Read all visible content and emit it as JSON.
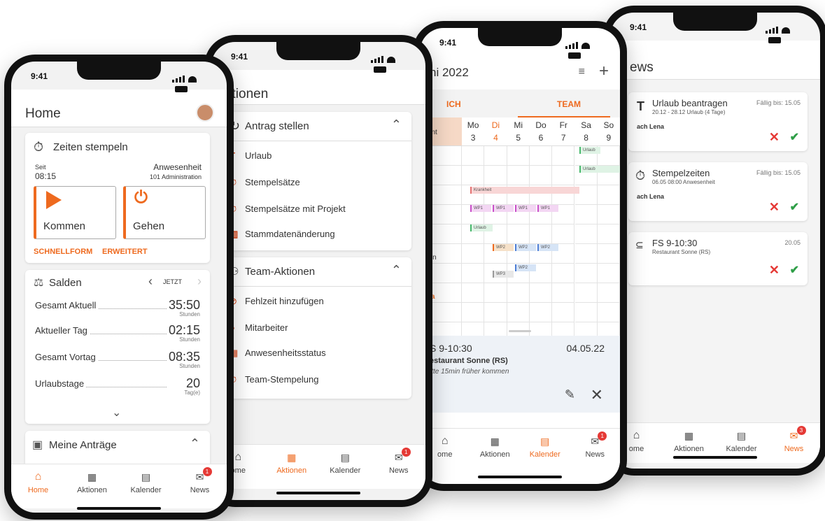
{
  "status_time": "9:41",
  "phone1": {
    "title": "Home",
    "stamp": {
      "title": "Zeiten stempeln",
      "since_label": "Seit",
      "since_time": "08:15",
      "presence_label": "Anwesenheit",
      "presence_value": "101 Administration",
      "kommen": "Kommen",
      "gehen": "Gehen",
      "schnellform": "SCHNELLFORM",
      "erweitert": "ERWEITERT"
    },
    "salden": {
      "title": "Salden",
      "jetzt": "JETZT",
      "rows": [
        {
          "label": "Gesamt Aktuell",
          "value": "35:50",
          "unit": "Stunden"
        },
        {
          "label": "Aktueller Tag",
          "value": "02:15",
          "unit": "Stunden"
        },
        {
          "label": "Gesamt Vortag",
          "value": "08:35",
          "unit": "Stunden"
        },
        {
          "label": "Urlaubstage",
          "value": "20",
          "unit": "Tag(e)"
        }
      ]
    },
    "antraege_title": "Meine Anträge"
  },
  "phone2": {
    "title": "ktionen",
    "antrag_section": "Antrag stellen",
    "antrag_items": [
      "Urlaub",
      "Stempelsätze",
      "Stempelsätze mit Projekt",
      "Stammdatenänderung"
    ],
    "team_section": "Team-Aktionen",
    "team_items": [
      "Fehlzeit hinzufügen",
      "Mitarbeiter",
      "Anwesenheitsstatus",
      "Team-Stempelung"
    ]
  },
  "phone3": {
    "title": "ni 2022",
    "tab_ich": "ICH",
    "tab_team": "TEAM",
    "first_col": "urant",
    "days": [
      {
        "dow": "Mo",
        "num": "3"
      },
      {
        "dow": "Di",
        "num": "4"
      },
      {
        "dow": "Mi",
        "num": "5"
      },
      {
        "dow": "Do",
        "num": "6"
      },
      {
        "dow": "Fr",
        "num": "7"
      },
      {
        "dow": "Sa",
        "num": "8"
      },
      {
        "dow": "So",
        "num": "9"
      }
    ],
    "row_names": [
      "a",
      "er",
      "",
      "r",
      "",
      "antin",
      "ow",
      "asia",
      "r",
      "",
      "k"
    ],
    "events": {
      "urlaub": "Urlaub",
      "krankheit": "Krankheit",
      "wp1": "WP1",
      "wp2": "WP2",
      "wp3": "WP3"
    },
    "detail": {
      "title": "S 9-10:30",
      "date": "04.05.22",
      "place": "estaurant Sonne (RS)",
      "note": "itte 15min früher kommen"
    }
  },
  "phone4": {
    "title": "ews",
    "items": [
      {
        "title": "Urlaub beantragen",
        "due": "Fällig bis: 15.05",
        "sub": "20.12 - 28.12 Urlaub (4 Tage)",
        "person": "ach Lena"
      },
      {
        "title": "Stempelzeiten",
        "due": "Fällig bis: 15.05",
        "sub": "06.05 08:00 Anwesenheit",
        "person": "ach Lena"
      },
      {
        "title": "FS 9-10:30",
        "due": "20.05",
        "sub": "Restaurant Sonne (RS)",
        "person": ""
      }
    ]
  },
  "tabs": {
    "home": "Home",
    "aktionen": "Aktionen",
    "kalender": "Kalender",
    "news": "News",
    "ome": "ome"
  },
  "badges": {
    "p1": "1",
    "p2": "1",
    "p3": "1",
    "p4": "3"
  },
  "colors": {
    "accent": "#ee6a1f",
    "danger": "#e53935",
    "ok": "#2e9e47"
  }
}
